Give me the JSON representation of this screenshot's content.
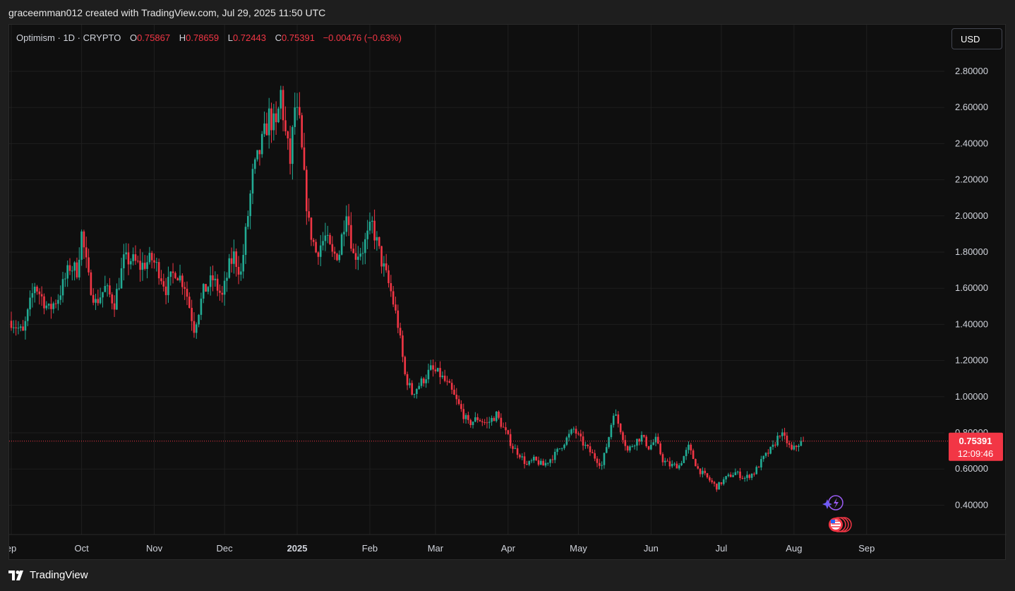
{
  "caption": "graceemman012 created with TradingView.com, Jul 29, 2025 11:50 UTC",
  "legend": {
    "symbol": "Optimism · 1D · CRYPTO",
    "o_label": "O",
    "o_value": "0.75867",
    "h_label": "H",
    "h_value": "0.78659",
    "l_label": "L",
    "l_value": "0.72443",
    "c_label": "C",
    "c_value": "0.75391",
    "change": "−0.00476 (−0.63%)"
  },
  "currency_button": "USD",
  "brand": "TradingView",
  "colors": {
    "up": "#22ab94",
    "down": "#f23645",
    "background": "#0f0f0f",
    "grid": "#1f1f1f"
  },
  "chart_data": {
    "type": "candlestick",
    "ylim": [
      0.24,
      2.98
    ],
    "y_ticks": [
      {
        "value": 2.8,
        "label": "2.80000"
      },
      {
        "value": 2.6,
        "label": "2.60000"
      },
      {
        "value": 2.4,
        "label": "2.40000"
      },
      {
        "value": 2.2,
        "label": "2.20000"
      },
      {
        "value": 2.0,
        "label": "2.00000"
      },
      {
        "value": 1.8,
        "label": "1.80000"
      },
      {
        "value": 1.6,
        "label": "1.60000"
      },
      {
        "value": 1.4,
        "label": "1.40000"
      },
      {
        "value": 1.2,
        "label": "1.20000"
      },
      {
        "value": 1.0,
        "label": "1.00000"
      },
      {
        "value": 0.8,
        "label": "0.80000"
      },
      {
        "value": 0.6,
        "label": "0.60000"
      },
      {
        "value": 0.4,
        "label": "0.40000"
      }
    ],
    "x_ticks": [
      {
        "label": "ep",
        "days": 0,
        "bold": false
      },
      {
        "label": "Oct",
        "days": 30,
        "bold": false
      },
      {
        "label": "Nov",
        "days": 61,
        "bold": false
      },
      {
        "label": "Dec",
        "days": 91,
        "bold": false
      },
      {
        "label": "2025",
        "days": 122,
        "bold": true
      },
      {
        "label": "Feb",
        "days": 153,
        "bold": false
      },
      {
        "label": "Mar",
        "days": 181,
        "bold": false
      },
      {
        "label": "Apr",
        "days": 212,
        "bold": false
      },
      {
        "label": "May",
        "days": 242,
        "bold": false
      },
      {
        "label": "Jun",
        "days": 273,
        "bold": false
      },
      {
        "label": "Jul",
        "days": 303,
        "bold": false
      },
      {
        "label": "Aug",
        "days": 334,
        "bold": false
      },
      {
        "label": "Sep",
        "days": 365,
        "bold": false
      }
    ],
    "last_price": {
      "value": 0.75391,
      "label": "0.75391",
      "countdown": "12:09:46"
    },
    "anchors": [
      [
        0,
        1.42
      ],
      [
        5,
        1.35
      ],
      [
        10,
        1.62
      ],
      [
        16,
        1.48
      ],
      [
        20,
        1.55
      ],
      [
        25,
        1.72
      ],
      [
        28,
        1.7
      ],
      [
        30,
        1.9
      ],
      [
        33,
        1.65
      ],
      [
        36,
        1.52
      ],
      [
        40,
        1.6
      ],
      [
        44,
        1.52
      ],
      [
        48,
        1.75
      ],
      [
        51,
        1.76
      ],
      [
        55,
        1.72
      ],
      [
        60,
        1.76
      ],
      [
        63,
        1.7
      ],
      [
        66,
        1.6
      ],
      [
        70,
        1.7
      ],
      [
        74,
        1.62
      ],
      [
        78,
        1.38
      ],
      [
        82,
        1.58
      ],
      [
        86,
        1.65
      ],
      [
        90,
        1.55
      ],
      [
        93,
        1.72
      ],
      [
        95,
        1.78
      ],
      [
        98,
        1.68
      ],
      [
        100,
        1.9
      ],
      [
        103,
        2.22
      ],
      [
        107,
        2.4
      ],
      [
        110,
        2.55
      ],
      [
        113,
        2.48
      ],
      [
        115,
        2.68
      ],
      [
        117,
        2.45
      ],
      [
        119,
        2.3
      ],
      [
        121,
        2.6
      ],
      [
        123,
        2.5
      ],
      [
        125,
        2.2
      ],
      [
        127,
        1.95
      ],
      [
        130,
        1.8
      ],
      [
        134,
        1.88
      ],
      [
        137,
        1.78
      ],
      [
        140,
        1.8
      ],
      [
        143,
        2.05
      ],
      [
        146,
        1.78
      ],
      [
        150,
        1.82
      ],
      [
        154,
        1.95
      ],
      [
        158,
        1.75
      ],
      [
        162,
        1.58
      ],
      [
        165,
        1.4
      ],
      [
        168,
        1.12
      ],
      [
        171,
        1.02
      ],
      [
        175,
        1.08
      ],
      [
        179,
        1.15
      ],
      [
        183,
        1.12
      ],
      [
        187,
        1.05
      ],
      [
        191,
        0.95
      ],
      [
        195,
        0.85
      ],
      [
        199,
        0.88
      ],
      [
        203,
        0.85
      ],
      [
        207,
        0.9
      ],
      [
        211,
        0.8
      ],
      [
        214,
        0.72
      ],
      [
        217,
        0.68
      ],
      [
        220,
        0.62
      ],
      [
        223,
        0.65
      ],
      [
        227,
        0.62
      ],
      [
        232,
        0.68
      ],
      [
        236,
        0.75
      ],
      [
        240,
        0.82
      ],
      [
        244,
        0.74
      ],
      [
        248,
        0.68
      ],
      [
        252,
        0.62
      ],
      [
        255,
        0.78
      ],
      [
        257,
        0.92
      ],
      [
        260,
        0.82
      ],
      [
        263,
        0.7
      ],
      [
        266,
        0.75
      ],
      [
        269,
        0.78
      ],
      [
        272,
        0.72
      ],
      [
        275,
        0.76
      ],
      [
        278,
        0.65
      ],
      [
        281,
        0.62
      ],
      [
        285,
        0.62
      ],
      [
        289,
        0.72
      ],
      [
        293,
        0.6
      ],
      [
        297,
        0.55
      ],
      [
        301,
        0.5
      ],
      [
        305,
        0.55
      ],
      [
        309,
        0.58
      ],
      [
        313,
        0.55
      ],
      [
        317,
        0.58
      ],
      [
        321,
        0.66
      ],
      [
        325,
        0.72
      ],
      [
        328,
        0.8
      ],
      [
        331,
        0.75
      ],
      [
        333,
        0.7
      ],
      [
        336,
        0.74
      ],
      [
        338,
        0.7539
      ]
    ]
  }
}
